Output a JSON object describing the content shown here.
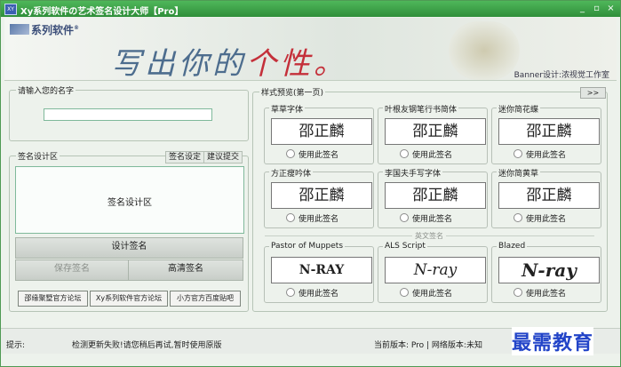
{
  "window": {
    "title": "Xy系列软件の艺术签名设计大师【Pro】",
    "app_icon": "XY",
    "min_label": "_",
    "max_label": "▫",
    "close_label": "×"
  },
  "banner": {
    "logo": "系列软件",
    "logo_mark": "®",
    "slogan_a": "写出你的",
    "slogan_b": "个性。",
    "studio": "Banner设计:浓视觉工作室"
  },
  "name_group": {
    "label": "请输入您的名字",
    "value": ""
  },
  "design_group": {
    "label": "签名设计区",
    "settings_btn": "签名设定",
    "suggest_btn": "建议提交",
    "area_text": "签名设计区",
    "design_btn": "设计签名",
    "save_btn": "保存签名",
    "hd_btn": "高清签名",
    "links": [
      "邵缘聚墅官方论坛",
      "Xy系列软件官方论坛",
      "小方官方百度贴吧"
    ]
  },
  "preview": {
    "label": "样式预览(第一页)",
    "next": ">>",
    "use_label": "使用此签名",
    "english_sep": "英文签名",
    "chinese_cards": [
      {
        "name": "草草字体",
        "sample": "邵正麟"
      },
      {
        "name": "叶根友钢笔行书简体",
        "sample": "邵正麟"
      },
      {
        "name": "迷你简花蝶",
        "sample": "邵正麟"
      },
      {
        "name": "方正瘦吟体",
        "sample": "邵正麟"
      },
      {
        "name": "李国夫手写字体",
        "sample": "邵正麟"
      },
      {
        "name": "迷你简黄草",
        "sample": "邵正麟"
      }
    ],
    "english_cards": [
      {
        "name": "Pastor of Muppets",
        "sample": "N-RAY"
      },
      {
        "name": "ALS Script",
        "sample": "N-ray"
      },
      {
        "name": "Blazed",
        "sample": "N-ray"
      }
    ]
  },
  "status": {
    "prompt_label": "提示:",
    "message": "检测更新失败!请您稍后再试,暂时使用原版",
    "version": "当前版本: Pro | 网络版本:未知"
  },
  "watermark": "最需教育"
}
